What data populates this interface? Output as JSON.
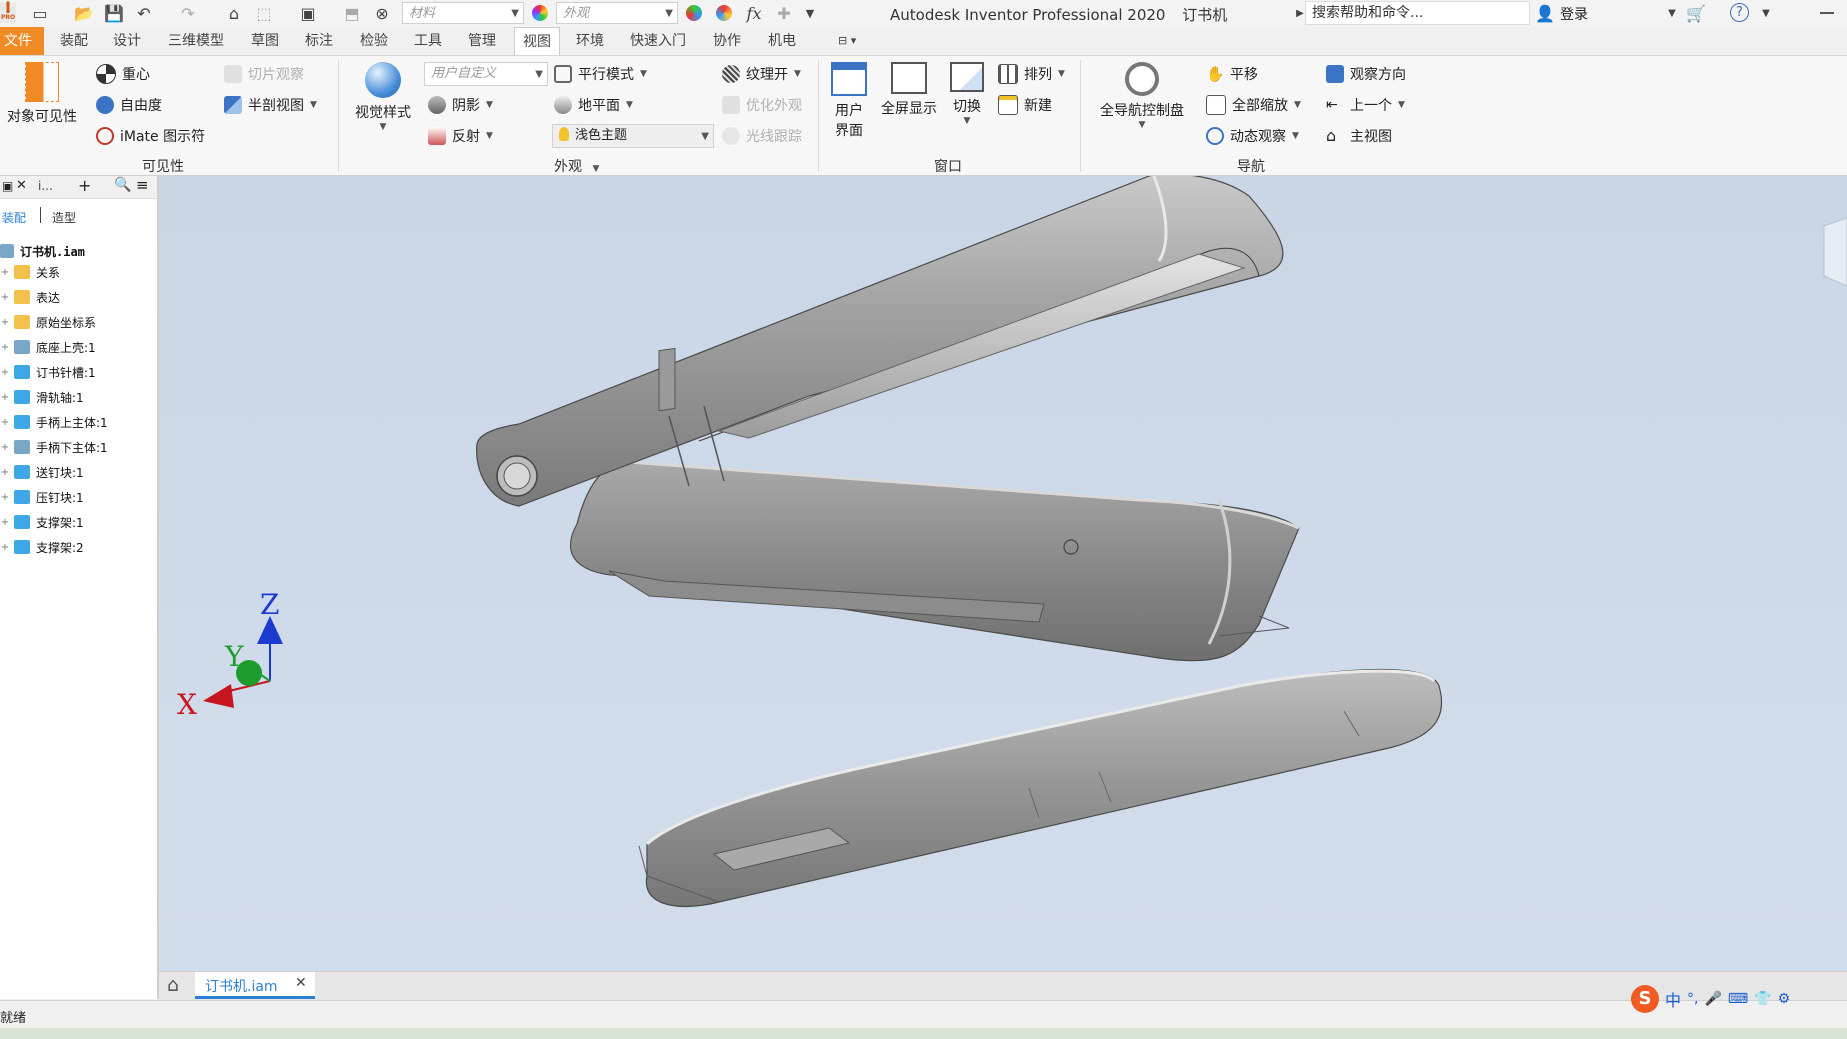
{
  "window": {
    "title": "Autodesk Inventor Professional 2020",
    "document": "订书机",
    "login": "登录"
  },
  "quick_access": {
    "logo_text": "I",
    "logo_sub": "PRO",
    "material_placeholder": "材料",
    "appearance_placeholder": "外观",
    "search_placeholder": "搜索帮助和命令..."
  },
  "menu": {
    "tabs": [
      "文件",
      "装配",
      "设计",
      "三维模型",
      "草图",
      "标注",
      "检验",
      "工具",
      "管理",
      "视图",
      "环境",
      "快速入门",
      "协作",
      "机电"
    ],
    "active": "视图"
  },
  "ribbon": {
    "visibility": {
      "object_visibility": "对象可见性",
      "center_of_gravity": "重心",
      "dof": "自由度",
      "imate_glyph": "iMate 图示符",
      "slice_graphics": "切片观察",
      "half_section": "半剖视图",
      "group_label": "可见性"
    },
    "appearance": {
      "visual_style": "视觉样式",
      "user_defined": "用户自定义",
      "shadows": "阴影",
      "reflections": "反射",
      "parallel_mode": "平行模式",
      "ground_plane": "地平面",
      "light_theme": "浅色主题",
      "texture_on": "纹理开",
      "optimize_appearance": "优化外观",
      "ray_tracing": "光线跟踪",
      "group_label": "外观"
    },
    "window": {
      "user_interface": "用户界面",
      "user_interface_line1": "用户",
      "user_interface_line2": "界面",
      "full_screen": "全屏显示",
      "switch": "切换",
      "arrange": "排列",
      "new_window": "新建",
      "group_label": "窗口"
    },
    "navigate": {
      "full_nav_wheel": "全导航控制盘",
      "pan": "平移",
      "zoom_all": "全部缩放",
      "orbit": "动态观察",
      "look_at": "观察方向",
      "previous": "上一个",
      "home_view": "主视图",
      "group_label": "导航"
    }
  },
  "browser": {
    "tab_label": "i...",
    "mode_assembly": "装配",
    "mode_modeling": "造型",
    "root": "订书机.iam",
    "items": [
      {
        "label": "关系",
        "type": "folder"
      },
      {
        "label": "表达",
        "type": "folder"
      },
      {
        "label": "原始坐标系",
        "type": "folder"
      },
      {
        "label": "底座上壳:1",
        "type": "asm"
      },
      {
        "label": "订书针槽:1",
        "type": "part"
      },
      {
        "label": "滑轨轴:1",
        "type": "part"
      },
      {
        "label": "手柄上主体:1",
        "type": "part"
      },
      {
        "label": "手柄下主体:1",
        "type": "asm"
      },
      {
        "label": "送钉块:1",
        "type": "part"
      },
      {
        "label": "压钉块:1",
        "type": "part"
      },
      {
        "label": "支撑架:1",
        "type": "part"
      },
      {
        "label": "支撑架:2",
        "type": "part"
      }
    ]
  },
  "axes": {
    "x": "X",
    "y": "Y",
    "z": "Z"
  },
  "doc_tab": "订书机.iam",
  "status": "就绪",
  "ime": {
    "lang": "中"
  },
  "colors": {
    "file_tab": "#f08a24",
    "viewport_bg": "#cdd9e9",
    "part_gray": "#8f8f8f",
    "axis_x": "#c8141e",
    "axis_y": "#1c9c2c",
    "axis_z": "#1a3ad0",
    "accent_blue": "#2b7fd6"
  }
}
